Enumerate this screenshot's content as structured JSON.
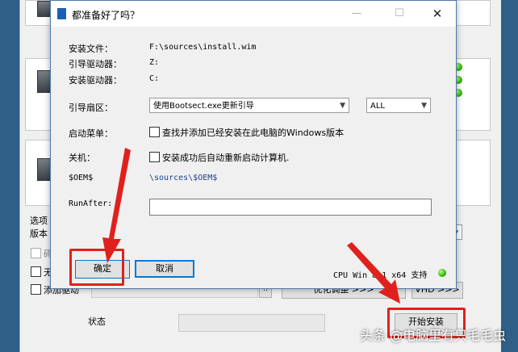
{
  "dialog": {
    "title": "都准备好了吗？",
    "install_file_label": "安装文件：",
    "install_file_value": "F:\\sources\\install.wim",
    "boot_drive_label": "引导驱动器：",
    "boot_drive_value": "Z:",
    "install_drive_label": "安装驱动器：",
    "install_drive_value": "C:",
    "boot_sector_label": "引导扇区：",
    "boot_sector_selected": "使用Bootsect.exe更新引导",
    "boot_target_selected": "ALL",
    "boot_menu_label": "启动菜单：",
    "boot_menu_option": "查找并添加已经安装在此电脑的Windows版本",
    "shutdown_label": "关机：",
    "shutdown_option": "安装成功后自动重新启动计算机.",
    "oem_label": "$OEM$",
    "oem_value": "\\sources\\$OEM$",
    "runafter_label": "RunAfter:",
    "runafter_value": "",
    "ok_button": "确定",
    "cancel_button": "取消"
  },
  "main": {
    "options_label": "选项",
    "version_label": "版本",
    "option_1_partial": "碍",
    "option_2_partial": "无",
    "add_driver_label": "添加驱动",
    "optimize_button": "优化调整 >>>",
    "vhd_button": "VHD >>>",
    "cpu_support_text": "CPU Win 8.1 x64 支持",
    "status_label": "状态",
    "start_install_button": "开始安装",
    "browse_dots": ".."
  },
  "watermark": "头条 @电脑里有只毛毛虫",
  "colors": {
    "highlight_red": "#e0201c",
    "led_green": "#31b800",
    "dialog_border": "#4a7ab0"
  }
}
